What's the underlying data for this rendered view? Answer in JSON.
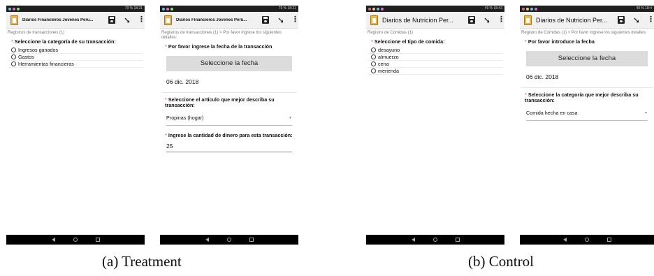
{
  "phones": [
    {
      "status": "79 % 18:21",
      "app_title": "Diarios Financieros Jovenes Peru...",
      "breadcrumb": "Registros de transacciones (1)",
      "question_req": "*",
      "question": "Seleccione la categoría de su transacción:",
      "options": [
        "Ingresos ganados",
        "Gastos",
        "Herramientas financieras"
      ]
    },
    {
      "status": "79 % 18:21",
      "app_title": "Diarios Financieros Jovenes Peru...",
      "breadcrumb": "Registros de transacciones (1) > Por favor ingrese los siguientes detalles:",
      "q1_req": "*",
      "q1": "Por favor ingrese la fecha de la transacción",
      "date_button": "Seleccione la fecha",
      "date_value": "06 dic. 2018",
      "q2_req": "*",
      "q2": "Seleccione el artículo que mejor describa su transacción:",
      "select_value": "Propinas (hogar)",
      "q3_req": "*",
      "q3": "Ingrese la cantidad de dinero para esta transacción:",
      "amount_value": "25"
    },
    {
      "status": "49 % 18:43",
      "app_title": "Diarios de Nutricion Per...",
      "breadcrumb": "Registro de Comidas (1)",
      "question_req": "*",
      "question": "Seleccione el tipo de comida:",
      "options": [
        "desayuno",
        "almuerzo",
        "cena",
        "merienda"
      ]
    },
    {
      "status": "49 % 18:4",
      "app_title": "Diarios de Nutricion Per...",
      "breadcrumb": "Registro de Comidas (1) > Por favor ingrese los siguientes detalles:",
      "q1_req": "*",
      "q1": "Por favor introduce la fecha",
      "date_button": "Seleccione la fecha",
      "date_value": "06 dic. 2018",
      "q2_req": "*",
      "q2": "Seleccione la categoría que mejor describa su transacción:",
      "select_value": "Comida hecha en casa"
    }
  ],
  "captions": {
    "treatment": "(a)  Treatment",
    "control": "(b)  Control"
  },
  "colors": {
    "required": "#e23b2f",
    "app_icon": "#e9b64c",
    "date_button_bg": "#dcdcdc"
  },
  "icons": {
    "app": "clipboard-icon",
    "save": "save-icon",
    "send": "send-icon",
    "menu": "overflow-menu-icon",
    "nav": [
      "back-icon",
      "home-icon",
      "recents-icon"
    ]
  }
}
